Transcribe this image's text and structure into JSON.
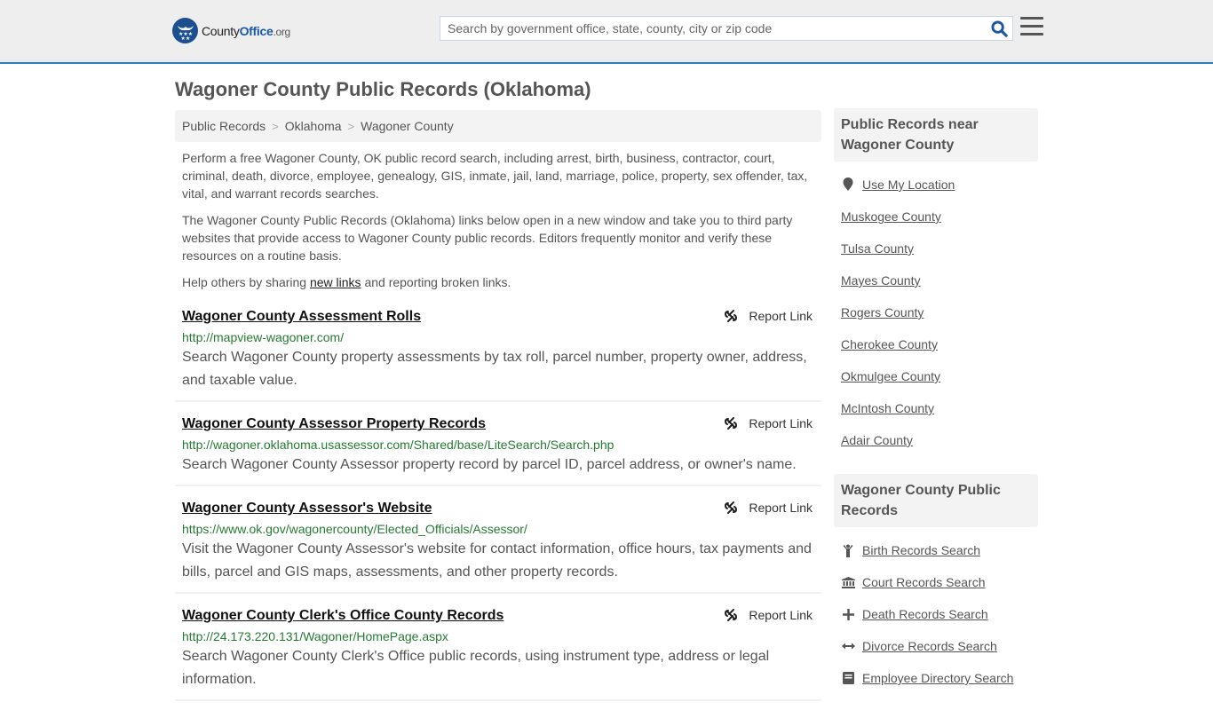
{
  "header": {
    "logo": {
      "name": "County",
      "office": "Office",
      "tld": ".org"
    },
    "search": {
      "placeholder": "Search by government office, state, county, city or zip code",
      "value": ""
    },
    "colors": {
      "accent": "#337ab7",
      "brand": "#1b4f8e"
    }
  },
  "page": {
    "title": "Wagoner County Public Records (Oklahoma)"
  },
  "breadcrumb": [
    {
      "label": "Public Records"
    },
    {
      "label": "Oklahoma"
    },
    {
      "label": "Wagoner County"
    }
  ],
  "breadcrumb_separator": ">",
  "intro": {
    "p1": "Perform a free Wagoner County, OK public record search, including arrest, birth, business, contractor, court, criminal, death, divorce, employee, genealogy, GIS, inmate, jail, land, marriage, police, property, sex offender, tax, vital, and warrant records searches.",
    "p2": "The Wagoner County Public Records (Oklahoma) links below open in a new window and take you to third party websites that provide access to Wagoner County public records. Editors frequently monitor and verify these resources on a routine basis.",
    "p3_before": "Help others by sharing ",
    "p3_link": "new links",
    "p3_after": " and reporting broken links."
  },
  "records": [
    {
      "title": "Wagoner County Assessment Rolls",
      "url": "http://mapview-wagoner.com/",
      "description": "Search Wagoner County property assessments by tax roll, parcel number, property owner, address, and taxable value.",
      "report_label": "Report Link"
    },
    {
      "title": "Wagoner County Assessor Property Records",
      "url": "http://wagoner.oklahoma.usassessor.com/Shared/base/LiteSearch/Search.php",
      "description": "Search Wagoner County Assessor property record by parcel ID, parcel address, or owner's name.",
      "report_label": "Report Link"
    },
    {
      "title": "Wagoner County Assessor's Website",
      "url": "https://www.ok.gov/wagonercounty/Elected_Officials/Assessor/",
      "description": "Visit the Wagoner County Assessor's website for contact information, office hours, tax payments and bills, parcel and GIS maps, assessments, and other property records.",
      "report_label": "Report Link"
    },
    {
      "title": "Wagoner County Clerk's Office County Records",
      "url": "http://24.173.220.131/Wagoner/HomePage.aspx",
      "description": "Search Wagoner County Clerk's Office public records, using instrument type, address or legal information.",
      "report_label": "Report Link"
    }
  ],
  "sidebar": {
    "nearby": {
      "heading": "Public Records near Wagoner County",
      "use_location": {
        "label": "Use My Location",
        "icon": "map-marker-icon"
      },
      "counties": [
        "Muskogee County",
        "Tulsa County",
        "Mayes County",
        "Rogers County",
        "Cherokee County",
        "Okmulgee County",
        "McIntosh County",
        "Adair County"
      ]
    },
    "county_records": {
      "heading": "Wagoner County Public Records",
      "items": [
        {
          "label": "Birth Records Search",
          "icon": "child-icon"
        },
        {
          "label": "Court Records Search",
          "icon": "courthouse-icon"
        },
        {
          "label": "Death Records Search",
          "icon": "plus-icon"
        },
        {
          "label": "Divorce Records Search",
          "icon": "arrows-horizontal-icon"
        },
        {
          "label": "Employee Directory Search",
          "icon": "id-card-icon"
        }
      ]
    }
  }
}
